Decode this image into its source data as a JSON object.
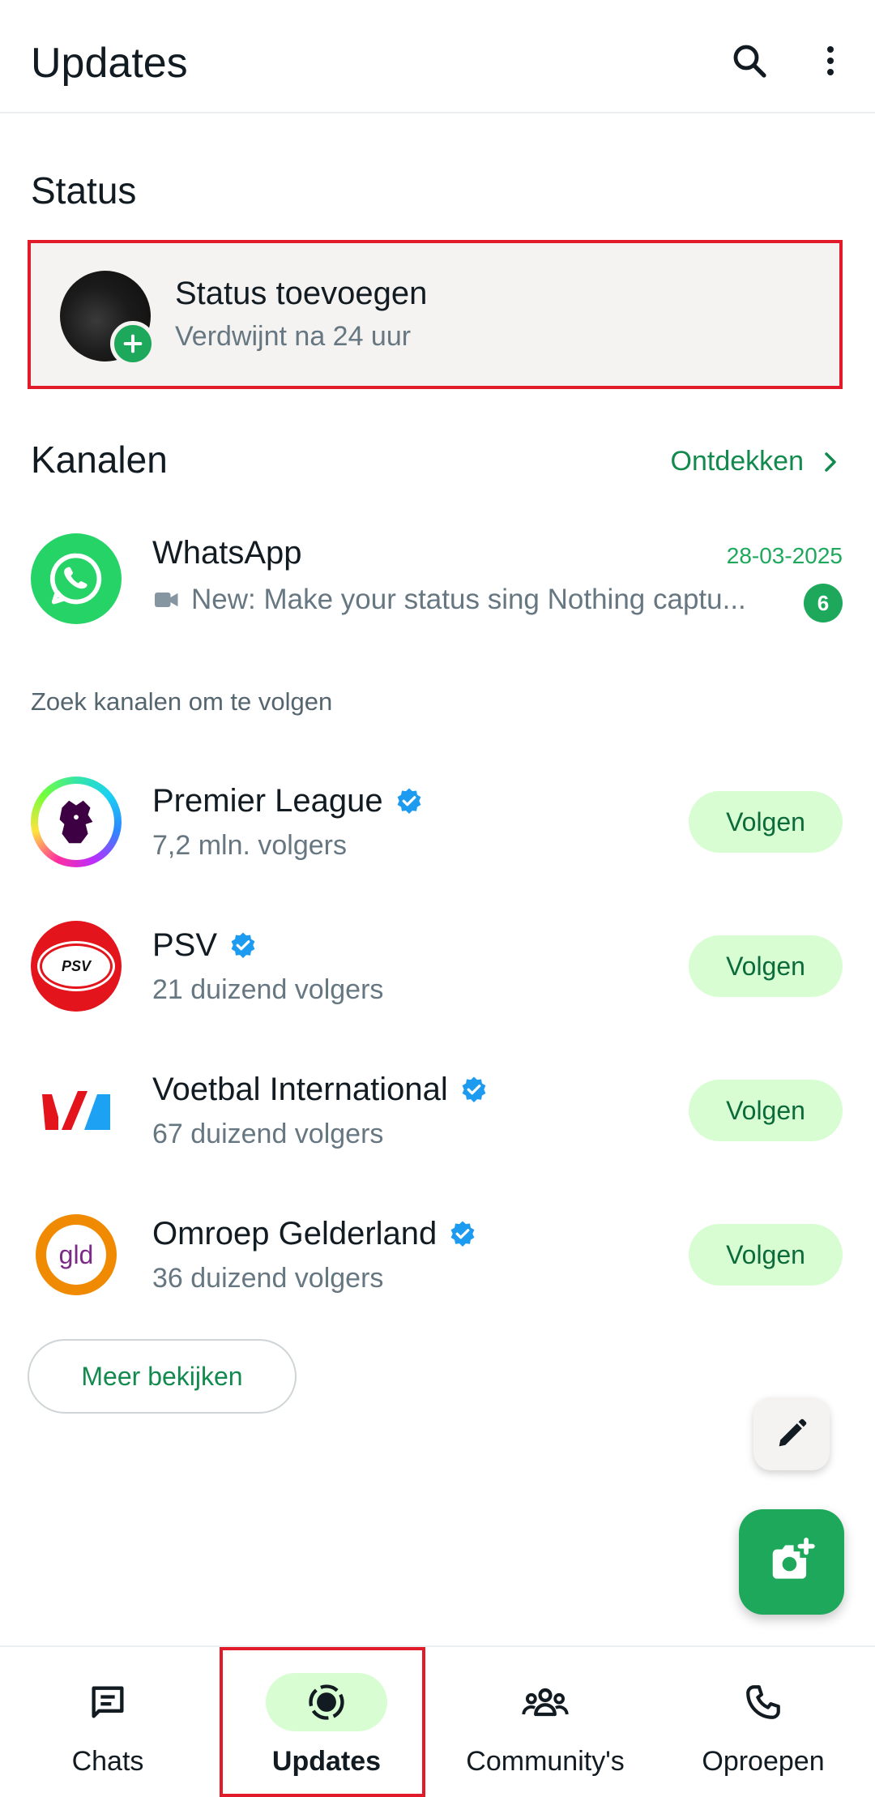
{
  "header": {
    "title": "Updates"
  },
  "status": {
    "section_title": "Status",
    "add_title": "Status toevoegen",
    "add_subtitle": "Verdwijnt na 24 uur"
  },
  "channels": {
    "section_title": "Kanalen",
    "discover_label": "Ontdekken",
    "followed": {
      "name": "WhatsApp",
      "date": "28-03-2025",
      "message": "New: Make your status sing Nothing captu...",
      "unread_count": "6"
    },
    "suggest_hint": "Zoek kanalen om te volgen",
    "suggestions": [
      {
        "name": "Premier League",
        "followers": "7,2 mln. volgers",
        "follow_label": "Volgen"
      },
      {
        "name": "PSV",
        "followers": "21 duizend volgers",
        "follow_label": "Volgen"
      },
      {
        "name": "Voetbal International",
        "followers": "67 duizend volgers",
        "follow_label": "Volgen"
      },
      {
        "name": "Omroep Gelderland",
        "followers": "36 duizend volgers",
        "follow_label": "Volgen"
      }
    ],
    "more_label": "Meer bekijken",
    "logo_texts": {
      "psv": "PSV",
      "gld": "gld"
    }
  },
  "bottom_nav": {
    "items": [
      {
        "label": "Chats"
      },
      {
        "label": "Updates"
      },
      {
        "label": "Community's"
      },
      {
        "label": "Oproepen"
      }
    ],
    "active": "Updates"
  },
  "colors": {
    "accent": "#1ea85b",
    "accent_dark": "#138a4d",
    "follow_bg": "#d9fdd3",
    "highlight_border": "#e11b2a",
    "verified": "#1d9bf0"
  },
  "icons": {
    "header": [
      "search-icon",
      "more-vert-icon"
    ],
    "discover": "chevron-right-icon",
    "message": "video-icon",
    "fabs": [
      "pencil-icon",
      "camera-add-icon"
    ],
    "nav": [
      "chats-icon",
      "updates-icon",
      "communities-icon",
      "calls-icon"
    ]
  }
}
